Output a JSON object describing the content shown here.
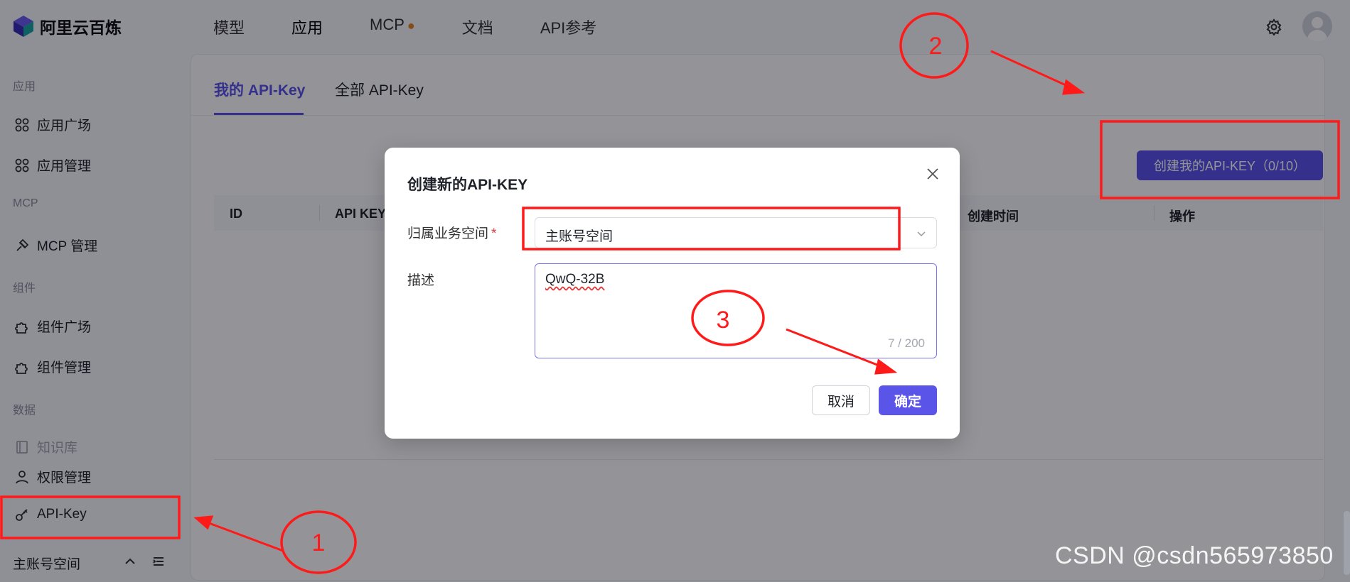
{
  "app": {
    "brand": "阿里云百炼"
  },
  "topnav": [
    "模型",
    "应用",
    "MCP",
    "文档",
    "API参考"
  ],
  "sidebar": {
    "section_app": "应用",
    "app_square": "应用广场",
    "app_manage": "应用管理",
    "section_mcp": "MCP",
    "mcp_manage": "MCP 管理",
    "section_component": "组件",
    "comp_square": "组件广场",
    "comp_manage": "组件管理",
    "section_data": "数据",
    "knowledge": "知识库",
    "permission": "权限管理",
    "apikey": "API-Key",
    "workspace": "主账号空间"
  },
  "main": {
    "tabs": [
      "我的 API-Key",
      "全部 API-Key"
    ],
    "create_button": "创建我的API-KEY（0/10）",
    "columns": [
      "ID",
      "API KEY",
      "创建时间",
      "操作"
    ]
  },
  "dialog": {
    "title": "创建新的API-KEY",
    "workspace_label": "归属业务空间",
    "required_mark": "*",
    "workspace_value": "主账号空间",
    "desc_label": "描述",
    "desc_value": "QwQ-32B",
    "desc_count": "7 / 200",
    "cancel": "取消",
    "ok": "确定"
  },
  "annotations": {
    "n1": "1",
    "n2": "2",
    "n3": "3"
  },
  "watermark": "CSDN @csdn565973850",
  "colors": {
    "accent": "#5b54e8",
    "annotation": "#ff1a1a"
  }
}
